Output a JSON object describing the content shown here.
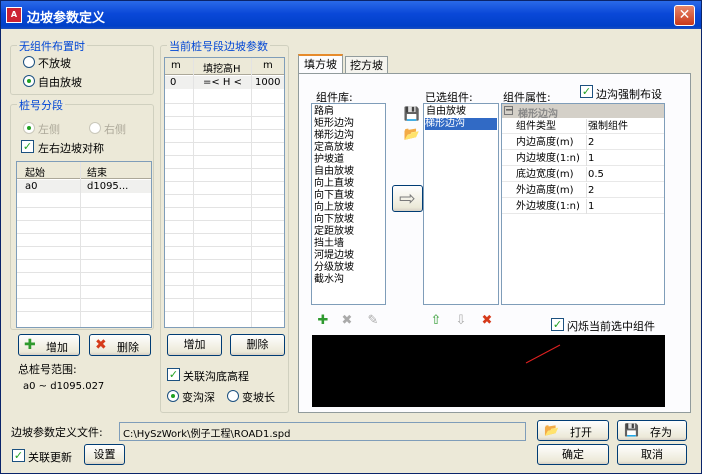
{
  "window": {
    "title": "边坡参数定义"
  },
  "no_component": {
    "group_label": "无组件布置时",
    "opt1": "不放坡",
    "opt2": "自由放坡",
    "selected": "自由放坡"
  },
  "station_seg": {
    "group_label": "桩号分段",
    "left": "左侧",
    "right": "右侧",
    "symmetric_label": "左右边坡对称",
    "symmetric_checked": true,
    "headers": [
      "起始",
      "结束"
    ],
    "rows": [
      [
        "a0",
        "d1095..."
      ]
    ],
    "add": "增加",
    "delete": "删除",
    "range_label": "总桩号范围:",
    "range_value": "a0 ~ d1095.027"
  },
  "current_seg": {
    "group_label": "当前桩号段边坡参数",
    "headers": [
      "m",
      "填挖高H",
      "m"
    ],
    "rows": [
      [
        "0",
        "=< H <",
        "1000"
      ]
    ],
    "add": "增加",
    "delete": "删除",
    "link_label": "关联沟底高程",
    "link_checked": true,
    "opt1": "变沟深",
    "opt2": "变坡长",
    "selected": "变沟深"
  },
  "tabs": {
    "fill": "填方坡",
    "cut": "挖方坡",
    "active": "填方坡"
  },
  "library": {
    "label": "组件库:",
    "items": [
      "路肩",
      "矩形边沟",
      "梯形边沟",
      "定高放坡",
      "护坡道",
      "自由放坡",
      "向上直坡",
      "向下直坡",
      "向上放坡",
      "向下放坡",
      "定距放坡",
      "挡土墙",
      "河堤边坡",
      "分级放坡",
      "截水沟"
    ]
  },
  "selected": {
    "label": "已选组件:",
    "items": [
      "自由放坡",
      "梯形边沟"
    ],
    "highlight": "梯形边沟"
  },
  "props": {
    "label": "组件属性:",
    "force_label": "边沟强制布设",
    "force_checked": true,
    "group": "梯形边沟",
    "rows": [
      [
        "组件类型",
        "强制组件"
      ],
      [
        "内边高度(m)",
        "2"
      ],
      [
        "内边坡度(1:n)",
        "1"
      ],
      [
        "底边宽度(m)",
        "0.5"
      ],
      [
        "外边高度(m)",
        "2"
      ],
      [
        "外边坡度(1:n)",
        "1"
      ]
    ]
  },
  "flash": {
    "label": "闪烁当前选中组件",
    "checked": true
  },
  "file": {
    "label": "边坡参数定义文件:",
    "path": "C:\\HySzWork\\例子工程\\ROAD1.spd",
    "open": "打开",
    "save": "存为"
  },
  "bottom": {
    "link_update": "关联更新",
    "link_checked": true,
    "settings": "设置",
    "ok": "确定",
    "cancel": "取消"
  },
  "icons": {
    "add": "add-icon",
    "delete": "delete-icon",
    "edit": "edit-icon",
    "arrow": "arrow-right-icon"
  }
}
